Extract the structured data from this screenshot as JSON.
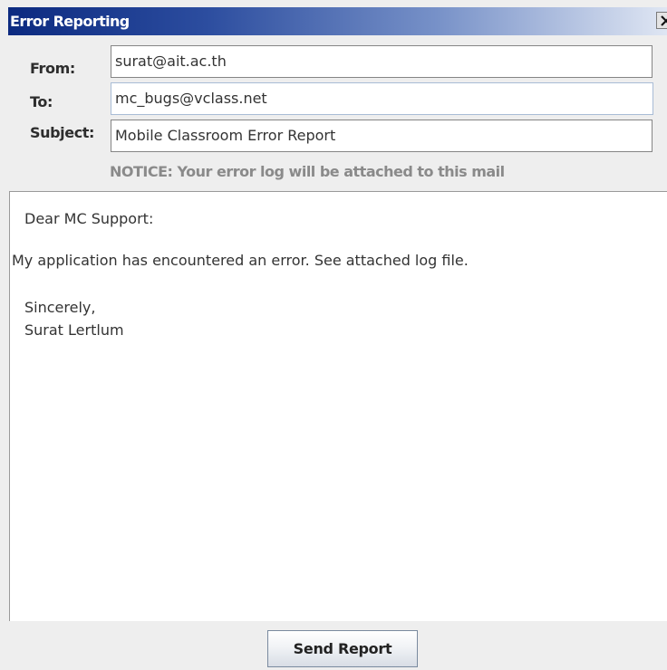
{
  "window": {
    "title": "Error Reporting"
  },
  "header": {
    "from_label": "From:",
    "from_value": "surat@ait.ac.th",
    "to_label": "To:",
    "to_value": "mc_bugs@vclass.net",
    "subject_label": "Subject:",
    "subject_value": "Mobile Classroom Error Report",
    "notice": "NOTICE: Your error log will be attached to this mail"
  },
  "message": {
    "lines": [
      "Dear MC Support:",
      "My application has encountered an error. See attached log file.",
      "Sincerely,",
      "Surat Lertlum"
    ]
  },
  "footer": {
    "send_label": "Send Report"
  },
  "icons": {
    "close": "close-icon"
  },
  "colors": {
    "title_bar_start": "#0c2a80",
    "title_bar_end": "#dfe6f3",
    "notice_text": "#8a8a8a"
  }
}
